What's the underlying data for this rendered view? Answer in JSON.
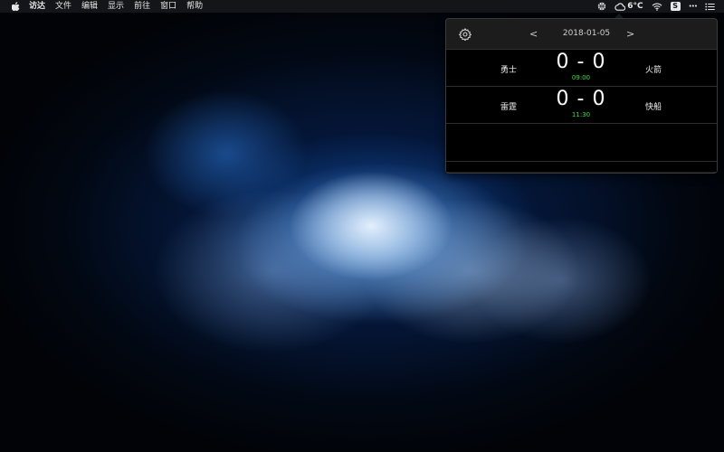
{
  "menubar": {
    "apple_icon": "apple-icon",
    "items": [
      {
        "label": "访达",
        "bold": true
      },
      {
        "label": "文件"
      },
      {
        "label": "编辑"
      },
      {
        "label": "显示"
      },
      {
        "label": "前往"
      },
      {
        "label": "窗口"
      },
      {
        "label": "帮助"
      }
    ],
    "status": {
      "weather_temp": "6°C",
      "icons": [
        "basketball-icon",
        "cloud-icon",
        "wifi-icon",
        "s-app-icon",
        "more-icon",
        "list-icon"
      ],
      "s_badge": "S",
      "more": "•••"
    }
  },
  "popover": {
    "settings_icon": "gear-icon",
    "prev": "<",
    "next": ">",
    "date": "2018-01-05",
    "games": [
      {
        "home": "勇士",
        "score": "0 - 0",
        "away": "火箭",
        "time": "09:00"
      },
      {
        "home": "雷霆",
        "score": "0 - 0",
        "away": "快船",
        "time": "11:30"
      }
    ],
    "time_color": "#3adf3a"
  }
}
